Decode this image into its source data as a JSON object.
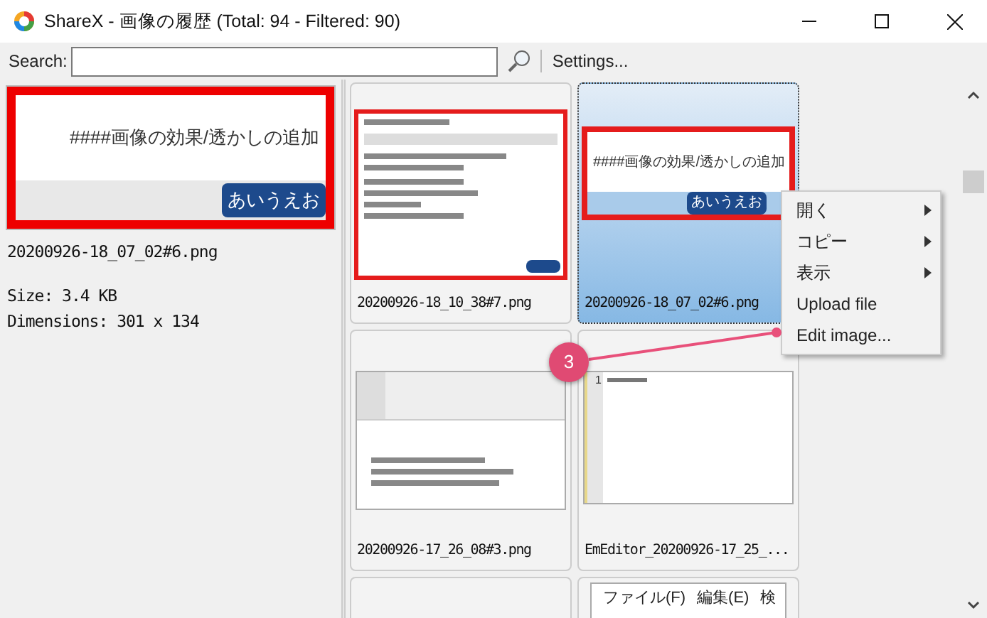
{
  "window": {
    "title": "ShareX - 画像の履歴 (Total: 94 - Filtered: 90)"
  },
  "toolbar": {
    "search_label": "Search:",
    "settings": "Settings..."
  },
  "preview": {
    "image_heading": "####画像の効果/透かしの追加",
    "image_button": "あいうえお",
    "filename": "20200926-18_07_02#6.png",
    "size": "Size: 3.4 KB",
    "dimensions": "Dimensions: 301 x 134"
  },
  "thumbnails": [
    {
      "kind": "editor",
      "filename": "20200926-18_10_38#7.png",
      "selected": false
    },
    {
      "kind": "preview",
      "filename": "20200926-18_07_02#6.png",
      "selected": true,
      "heading": "####画像の効果/透かしの追加",
      "button": "あいうえお"
    },
    {
      "kind": "notes",
      "filename": "20200926-17_26_08#3.png",
      "selected": false
    },
    {
      "kind": "code",
      "filename": "EmEditor_20200926-17_25_...",
      "selected": false,
      "line_number": "1"
    },
    {
      "kind": "empty",
      "selected": false
    },
    {
      "kind": "menubar",
      "selected": false,
      "menus": [
        "ファイル(F)",
        "編集(E)",
        "検"
      ]
    }
  ],
  "context_menu": {
    "items": [
      {
        "label": "開く",
        "submenu": true
      },
      {
        "label": "コピー",
        "submenu": true
      },
      {
        "label": "表示",
        "submenu": true
      },
      {
        "label": "Upload file",
        "submenu": false
      },
      {
        "label": "Edit image...",
        "submenu": false
      }
    ]
  },
  "annotation": {
    "number": "3"
  }
}
